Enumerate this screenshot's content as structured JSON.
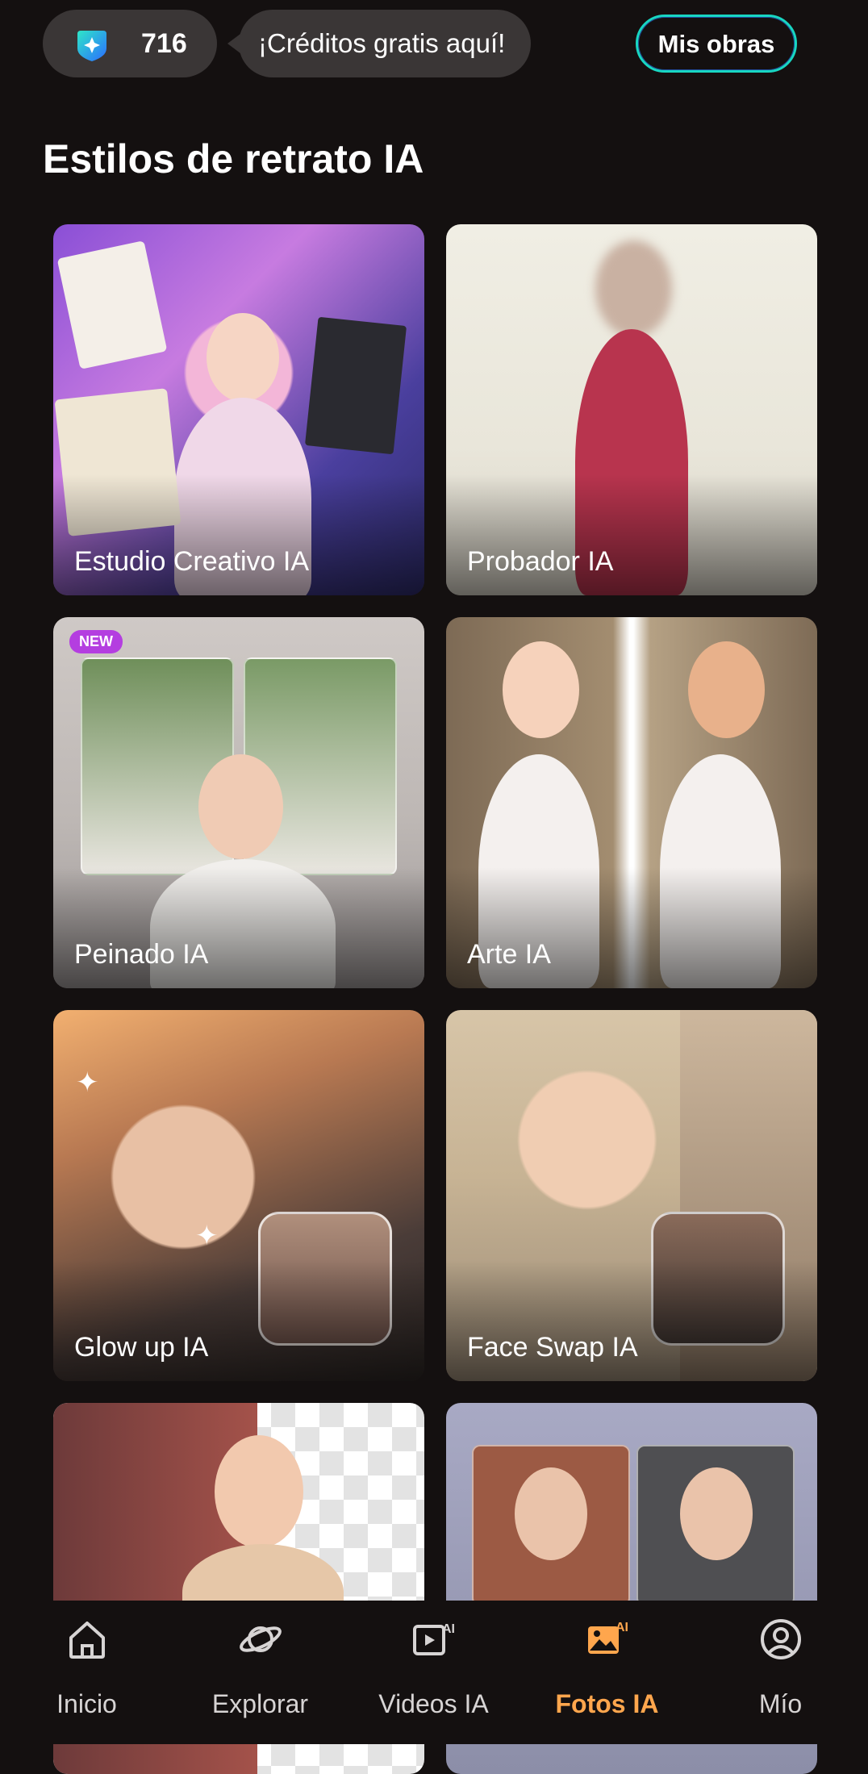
{
  "header": {
    "credits_value": "716",
    "promo_text": "¡Créditos gratis aquí!",
    "my_works_label": "Mis obras"
  },
  "section": {
    "title": "Estilos de retrato IA"
  },
  "cards": [
    {
      "label": "Estudio Creativo IA",
      "badge": ""
    },
    {
      "label": "Probador IA",
      "badge": ""
    },
    {
      "label": "Peinado IA",
      "badge": "NEW"
    },
    {
      "label": "Arte IA",
      "badge": ""
    },
    {
      "label": "Glow up IA",
      "badge": ""
    },
    {
      "label": "Face Swap IA",
      "badge": ""
    },
    {
      "label": "",
      "badge": ""
    },
    {
      "label": "",
      "badge": ""
    }
  ],
  "bottom_nav": {
    "items": [
      {
        "label": "Inicio",
        "icon": "home-icon",
        "active": false
      },
      {
        "label": "Explorar",
        "icon": "planet-icon",
        "active": false
      },
      {
        "label": "Videos IA",
        "icon": "ai-video-icon",
        "active": false
      },
      {
        "label": "Fotos IA",
        "icon": "ai-photo-icon",
        "active": true
      },
      {
        "label": "Mío",
        "icon": "profile-icon",
        "active": false
      }
    ]
  },
  "colors": {
    "background": "#141010",
    "accent_active": "#ffa64d",
    "button_border": "#18d6c2",
    "new_badge": "#b43ee0"
  }
}
